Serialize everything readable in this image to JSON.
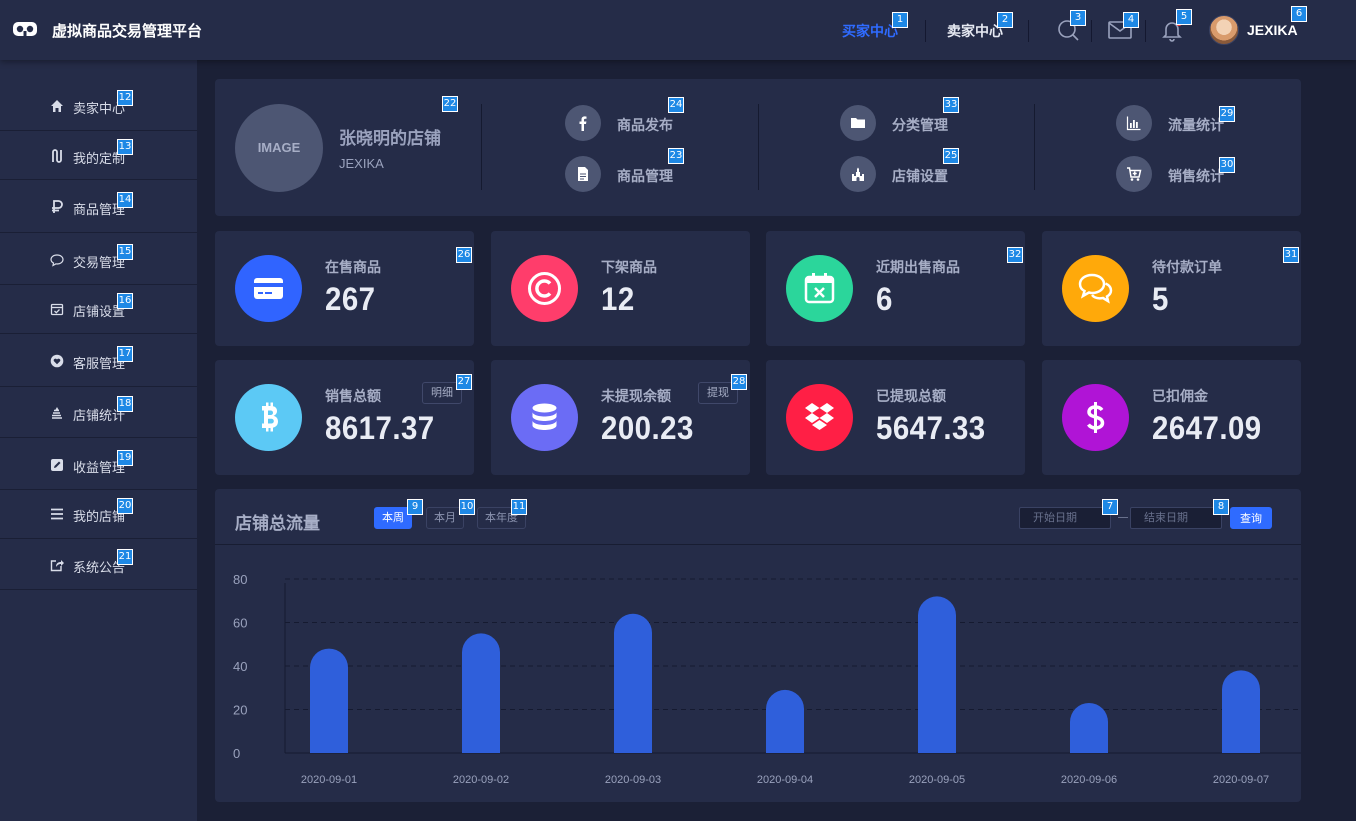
{
  "header": {
    "app_title": "虚拟商品交易管理平台",
    "nav": [
      {
        "label": "买家中心",
        "active": true
      },
      {
        "label": "卖家中心",
        "active": false
      }
    ],
    "icons": [
      "search-icon",
      "mail-icon",
      "bell-icon"
    ],
    "user_name": "JEXIKA",
    "accent_color": "#2f6bff"
  },
  "sidebar": {
    "items": [
      {
        "label": "卖家中心",
        "icon": "home-icon"
      },
      {
        "label": "我的定制",
        "icon": "custom-icon"
      },
      {
        "label": "商品管理",
        "icon": "ruble-icon"
      },
      {
        "label": "交易管理",
        "icon": "chat-bubble-icon"
      },
      {
        "label": "店铺设置",
        "icon": "calendar-check-icon"
      },
      {
        "label": "客服管理",
        "icon": "heart-icon"
      },
      {
        "label": "店铺统计",
        "icon": "stack-icon"
      },
      {
        "label": "收益管理",
        "icon": "edit-icon"
      },
      {
        "label": "我的店铺",
        "icon": "menu-icon"
      },
      {
        "label": "系统公告",
        "icon": "share-icon"
      }
    ]
  },
  "shop": {
    "avatar_text": "IMAGE",
    "name": "张晓明的店铺",
    "owner": "JEXIKA",
    "quick_links": [
      {
        "label": "商品发布",
        "icon": "facebook-icon"
      },
      {
        "label": "商品管理",
        "icon": "document-icon"
      },
      {
        "label": "分类管理",
        "icon": "folder-icon"
      },
      {
        "label": "店铺设置",
        "icon": "castle-icon"
      },
      {
        "label": "流量统计",
        "icon": "bar-chart-icon"
      },
      {
        "label": "销售统计",
        "icon": "cart-icon"
      }
    ]
  },
  "stats": [
    {
      "label": "在售商品",
      "value": "267",
      "color": "#3064ff",
      "icon": "card-icon"
    },
    {
      "label": "下架商品",
      "value": "12",
      "color": "#ff3d6b",
      "icon": "copyright-icon"
    },
    {
      "label": "近期出售商品",
      "value": "6",
      "color": "#2bd69b",
      "icon": "calendar-x-icon"
    },
    {
      "label": "待付款订单",
      "value": "5",
      "color": "#ffa90a",
      "icon": "comments-icon"
    },
    {
      "label": "销售总额",
      "value": "8617.37",
      "color": "#5cc9f5",
      "icon": "bitcoin-icon",
      "button": "明细"
    },
    {
      "label": "未提现余额",
      "value": "200.23",
      "color": "#6b6cf5",
      "icon": "database-icon",
      "button": "提现"
    },
    {
      "label": "已提现总额",
      "value": "5647.33",
      "color": "#ff1f45",
      "icon": "dropbox-icon"
    },
    {
      "label": "已扣佣金",
      "value": "2647.09",
      "color": "#b014d6",
      "icon": "dollar-icon"
    }
  ],
  "traffic": {
    "title": "店铺总流量",
    "tabs": [
      {
        "label": "本周",
        "active": true
      },
      {
        "label": "本月",
        "active": false
      },
      {
        "label": "本年度",
        "active": false
      }
    ],
    "start_placeholder": "开始日期",
    "end_placeholder": "结束日期",
    "query_label": "查询"
  },
  "chart_data": {
    "type": "bar",
    "categories": [
      "2020-09-01",
      "2020-09-02",
      "2020-09-03",
      "2020-09-04",
      "2020-09-05",
      "2020-09-06",
      "2020-09-07"
    ],
    "values": [
      48,
      55,
      64,
      29,
      72,
      23,
      38
    ],
    "ylim": [
      0,
      80
    ],
    "yticks": [
      0,
      20,
      40,
      60,
      80
    ],
    "grid": true,
    "bar_color": "#2f5fdb"
  },
  "annotations": [
    "1",
    "2",
    "3",
    "4",
    "5",
    "6",
    "7",
    "8",
    "9",
    "10",
    "11",
    "12",
    "13",
    "14",
    "15",
    "16",
    "17",
    "18",
    "19",
    "20",
    "21",
    "22",
    "23",
    "24",
    "25",
    "26",
    "27",
    "28",
    "29",
    "30",
    "31",
    "32",
    "33"
  ]
}
